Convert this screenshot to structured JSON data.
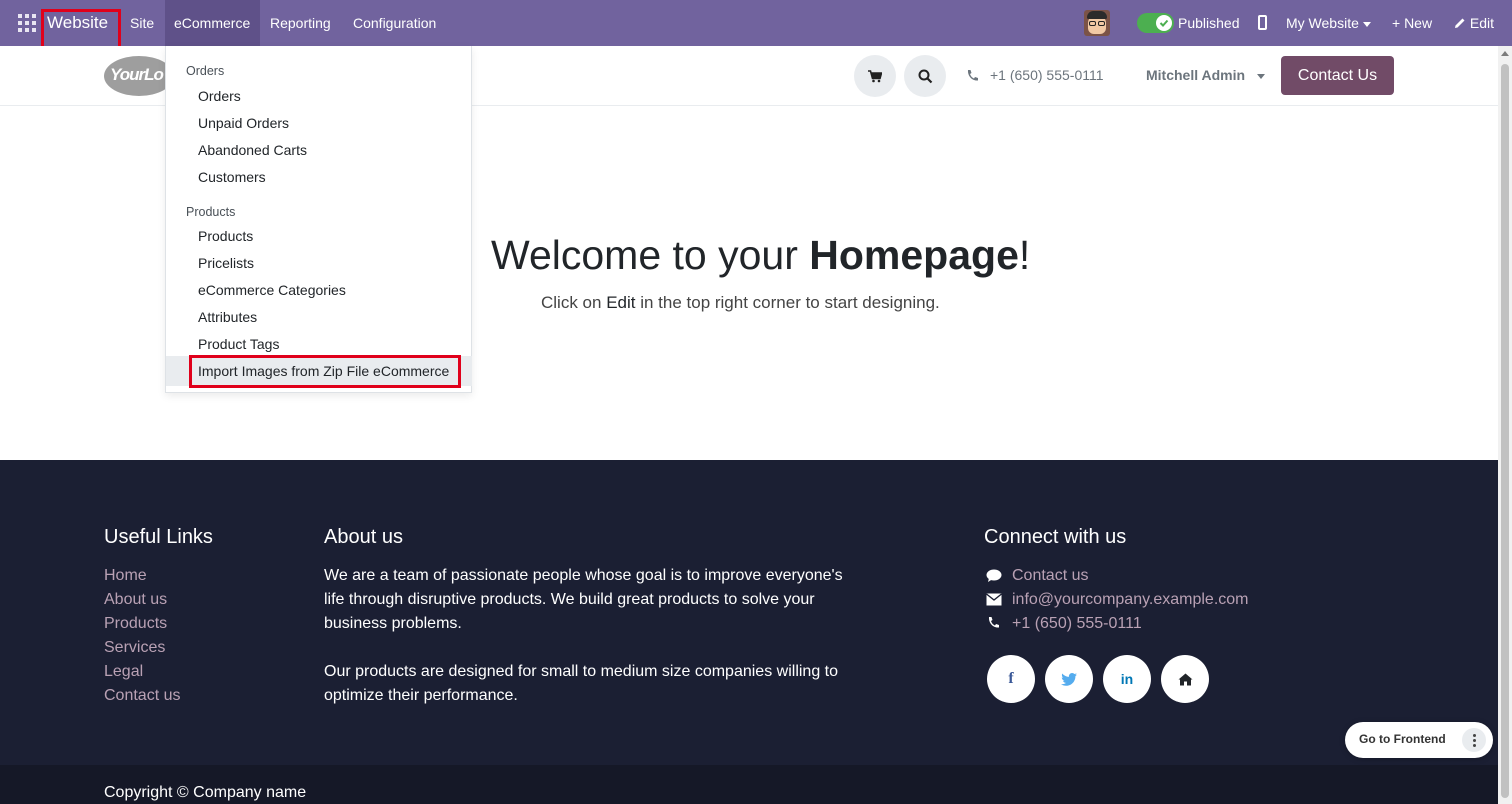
{
  "topbar": {
    "brand": "Website",
    "nav": [
      "Site",
      "eCommerce",
      "Reporting",
      "Configuration"
    ],
    "published_label": "Published",
    "my_website_label": "My Website",
    "new_label": "+ New",
    "edit_label": "Edit"
  },
  "header": {
    "logo_text": "YourLo",
    "phone": "+1 (650) 555-0111",
    "user": "Mitchell Admin",
    "contact_button": "Contact Us"
  },
  "dropdown": {
    "sections": [
      {
        "title": "Orders",
        "items": [
          "Orders",
          "Unpaid Orders",
          "Abandoned Carts",
          "Customers"
        ]
      },
      {
        "title": "Products",
        "items": [
          "Products",
          "Pricelists",
          "eCommerce Categories",
          "Attributes",
          "Product Tags",
          "Import Images from Zip File eCommerce"
        ]
      }
    ]
  },
  "hero": {
    "title_prefix": "Welcome to your ",
    "title_bold": "Homepage",
    "title_suffix": "!",
    "sub_prefix": "Click on ",
    "sub_bold": "Edit",
    "sub_suffix": " in the top right corner to start designing."
  },
  "footer": {
    "useful_links_title": "Useful Links",
    "useful_links": [
      "Home",
      "About us",
      "Products",
      "Services",
      "Legal",
      "Contact us"
    ],
    "about_title": "About us",
    "about_p1_lines": [
      "We are a team of passionate people whose goal is to improve everyone's",
      "life through disruptive products. We build great products to solve your",
      "business problems."
    ],
    "about_p2_lines": [
      "Our products are designed for small to medium size companies willing to",
      "optimize their performance."
    ],
    "connect_title": "Connect with us",
    "connect_items": [
      "Contact us",
      "info@yourcompany.example.com",
      "+1 (650) 555-0111"
    ],
    "social": [
      "f",
      "t",
      "in",
      "home"
    ],
    "copyright": "Copyright © Company name"
  },
  "floating": {
    "go_frontend": "Go to Frontend"
  },
  "colors": {
    "topbar": "#71639e",
    "accent": "#714b67",
    "footer": "#1b1f33",
    "highlight": "#e0001b"
  }
}
